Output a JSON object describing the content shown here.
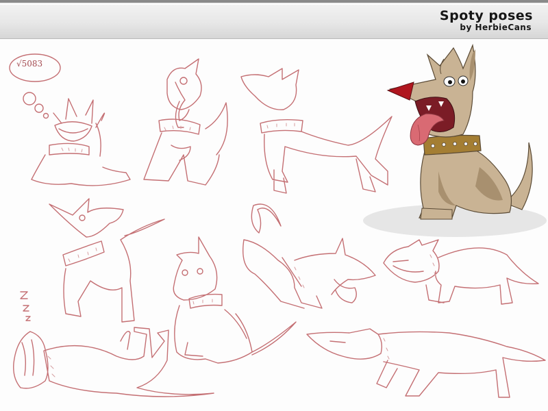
{
  "header": {
    "title": "Spoty poses",
    "subtitle": "by HerbieCans"
  },
  "thought_bubble": {
    "text": "√5083"
  },
  "sleep_marks": "Z z z z",
  "colors": {
    "sketch_line": "#c46f73",
    "dog_body": "#c9b394",
    "dog_shade": "#a8906f",
    "collar": "#a47e33",
    "nose": "#b0161f",
    "tongue": "#d96a73"
  }
}
